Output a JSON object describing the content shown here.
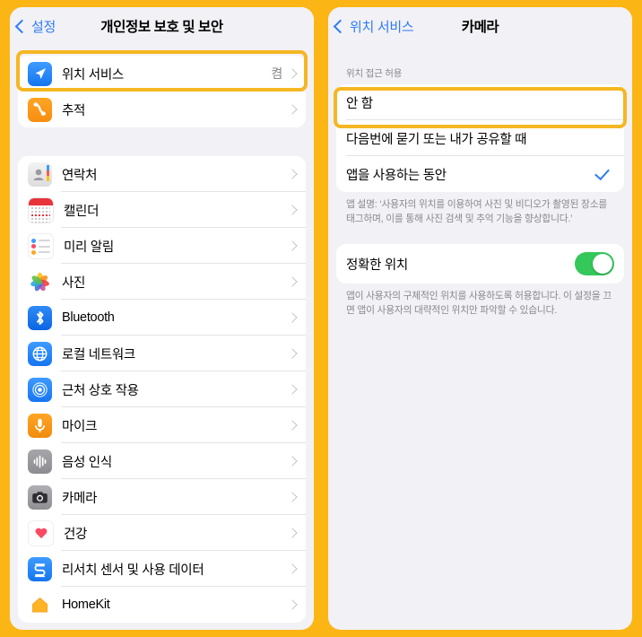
{
  "theme": {
    "frame_color": "#FBB615",
    "highlight_color": "#F5B722",
    "accent_blue": "#2E7CF6",
    "toggle_green": "#34C759",
    "panel_bg": "#F2F1F6",
    "card_bg": "#FFFFFF",
    "secondary_text": "#8A8A8E"
  },
  "left_panel": {
    "nav": {
      "back_label": "설정",
      "title": "개인정보 보호 및 보안",
      "back_icon": "chevron-left-icon"
    },
    "group_one": [
      {
        "label": "위치 서비스",
        "value": "켬",
        "icon": "location-arrow-icon",
        "highlighted": true
      },
      {
        "label": "추적",
        "value": "",
        "icon": "tracking-icon",
        "highlighted": false
      }
    ],
    "group_two": [
      {
        "label": "연락처",
        "value": "",
        "icon": "contacts-icon"
      },
      {
        "label": "캘린더",
        "value": "",
        "icon": "calendar-icon"
      },
      {
        "label": "미리 알림",
        "value": "",
        "icon": "reminders-icon"
      },
      {
        "label": "사진",
        "value": "",
        "icon": "photos-icon"
      },
      {
        "label": "Bluetooth",
        "value": "",
        "icon": "bluetooth-icon"
      },
      {
        "label": "로컬 네트워크",
        "value": "",
        "icon": "local-network-icon"
      },
      {
        "label": "근처 상호 작용",
        "value": "",
        "icon": "nearby-interactions-icon"
      },
      {
        "label": "마이크",
        "value": "",
        "icon": "microphone-icon"
      },
      {
        "label": "음성 인식",
        "value": "",
        "icon": "speech-recognition-icon"
      },
      {
        "label": "카메라",
        "value": "",
        "icon": "camera-icon"
      },
      {
        "label": "건강",
        "value": "",
        "icon": "health-icon"
      },
      {
        "label": "리서치 센서 및 사용 데이터",
        "value": "",
        "icon": "research-sensor-icon"
      },
      {
        "label": "HomeKit",
        "value": "",
        "icon": "homekit-icon"
      }
    ]
  },
  "right_panel": {
    "nav": {
      "back_label": "위치 서비스",
      "title": "카메라",
      "back_icon": "chevron-left-icon"
    },
    "access_section": {
      "header": "위치 접근 허용",
      "options": [
        {
          "label": "안 함",
          "selected": false,
          "highlighted": true
        },
        {
          "label": "다음번에 묻기 또는 내가 공유할 때",
          "selected": false,
          "highlighted": false
        },
        {
          "label": "앱을 사용하는 동안",
          "selected": true,
          "highlighted": false
        }
      ],
      "footer": "앱 설명: ‘사용자의 위치를 이용하여 사진 및 비디오가 촬영된 장소를 태그하며, 이를 통해 사진 검색 및 추억 기능을 향상합니다.’"
    },
    "precise_section": {
      "row_label": "정확한 위치",
      "toggle_on": true,
      "footer": "앱이 사용자의 구체적인 위치를 사용하도록 허용합니다. 이 설정을 끄면 앱이 사용자의 대략적인 위치만 파악할 수 있습니다."
    }
  }
}
